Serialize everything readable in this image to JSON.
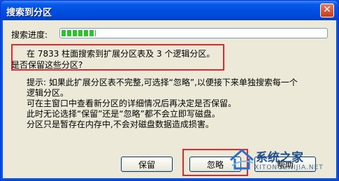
{
  "window": {
    "title": "搜索到分区",
    "close_symbol": "✕"
  },
  "progress": {
    "label": "搜索进度:",
    "fraction": 0.13
  },
  "message": {
    "line1": "在 7833 柱面搜索到扩展分区表及 3 个逻辑分区。",
    "line2": "是否保留这些分区?"
  },
  "hint": {
    "lines": [
      "提示: 如果此扩展分区表不完整,可选择“忽略”,以便接下来单独搜索每一个",
      "逻辑分区。",
      "可在主窗口中查看新分区的详细情况后再决定是否保留。",
      "此时无论选择“保留”还是“忽略”都不会立即写磁盘。",
      "分区只是暂存在内存中,不会对磁盘数据造成损害。"
    ]
  },
  "buttons": {
    "keep": "保留",
    "ignore": "忽略",
    "help": "帮助"
  },
  "watermark": {
    "text": "系统之家",
    "url": "XITONGZHIJIA.NET"
  },
  "colors": {
    "highlight": "#e8262b",
    "progress": "#2fc22f",
    "titlebar": "#0050e0"
  }
}
